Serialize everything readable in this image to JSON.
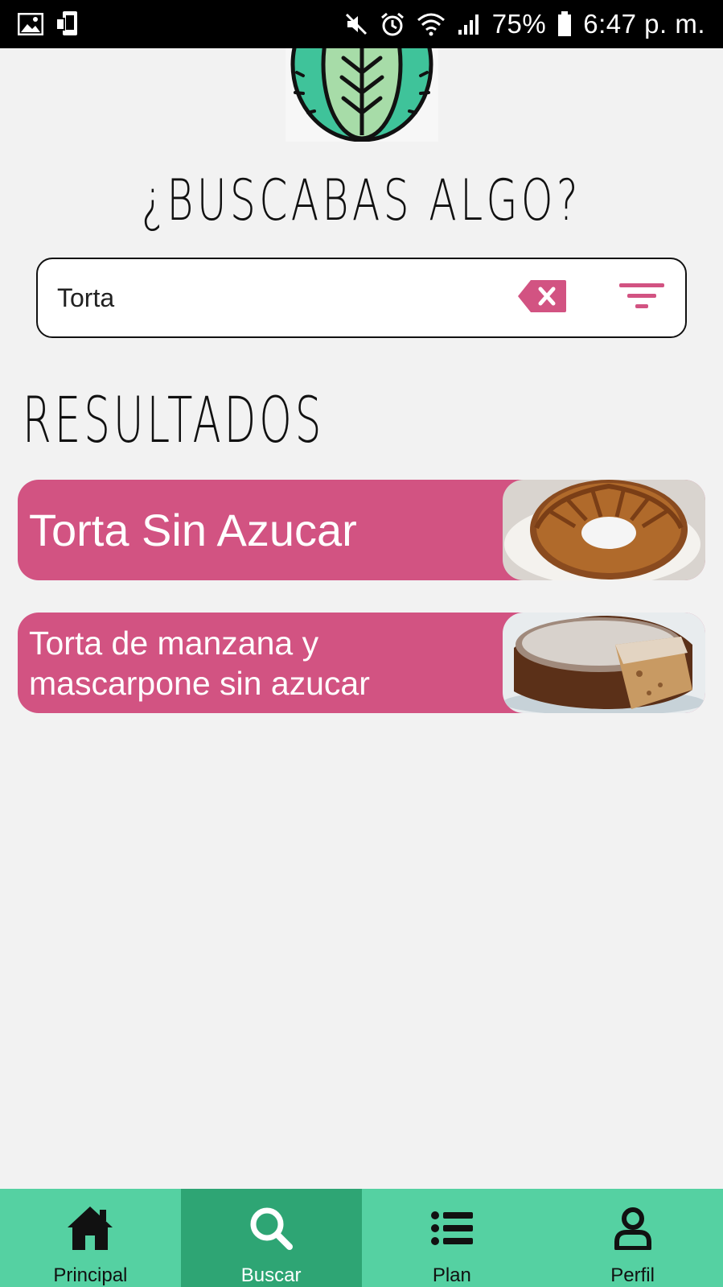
{
  "status_bar": {
    "battery": "75%",
    "time": "6:47 p. m."
  },
  "header": {
    "title": "¿BUSCABAS ALGO?"
  },
  "search": {
    "value": "Torta",
    "clear_icon": "backspace-clear-icon",
    "filter_icon": "filter-icon"
  },
  "results": {
    "heading": "RESULTADOS",
    "items": [
      {
        "title": "Torta Sin Azucar",
        "image": "bundt-cake-image"
      },
      {
        "title": "Torta de manzana y mascarpone sin azucar",
        "image": "apple-cake-image"
      }
    ]
  },
  "bottom_nav": {
    "items": [
      {
        "label": "Principal",
        "icon": "home-icon",
        "active": false
      },
      {
        "label": "Buscar",
        "icon": "search-icon",
        "active": true
      },
      {
        "label": "Plan",
        "icon": "list-icon",
        "active": false
      },
      {
        "label": "Perfil",
        "icon": "user-icon",
        "active": false
      }
    ]
  },
  "colors": {
    "accent_pink": "#d25382",
    "nav_green": "#55d1a2",
    "nav_active_green": "#2ea574",
    "background": "#f2f2f2"
  }
}
